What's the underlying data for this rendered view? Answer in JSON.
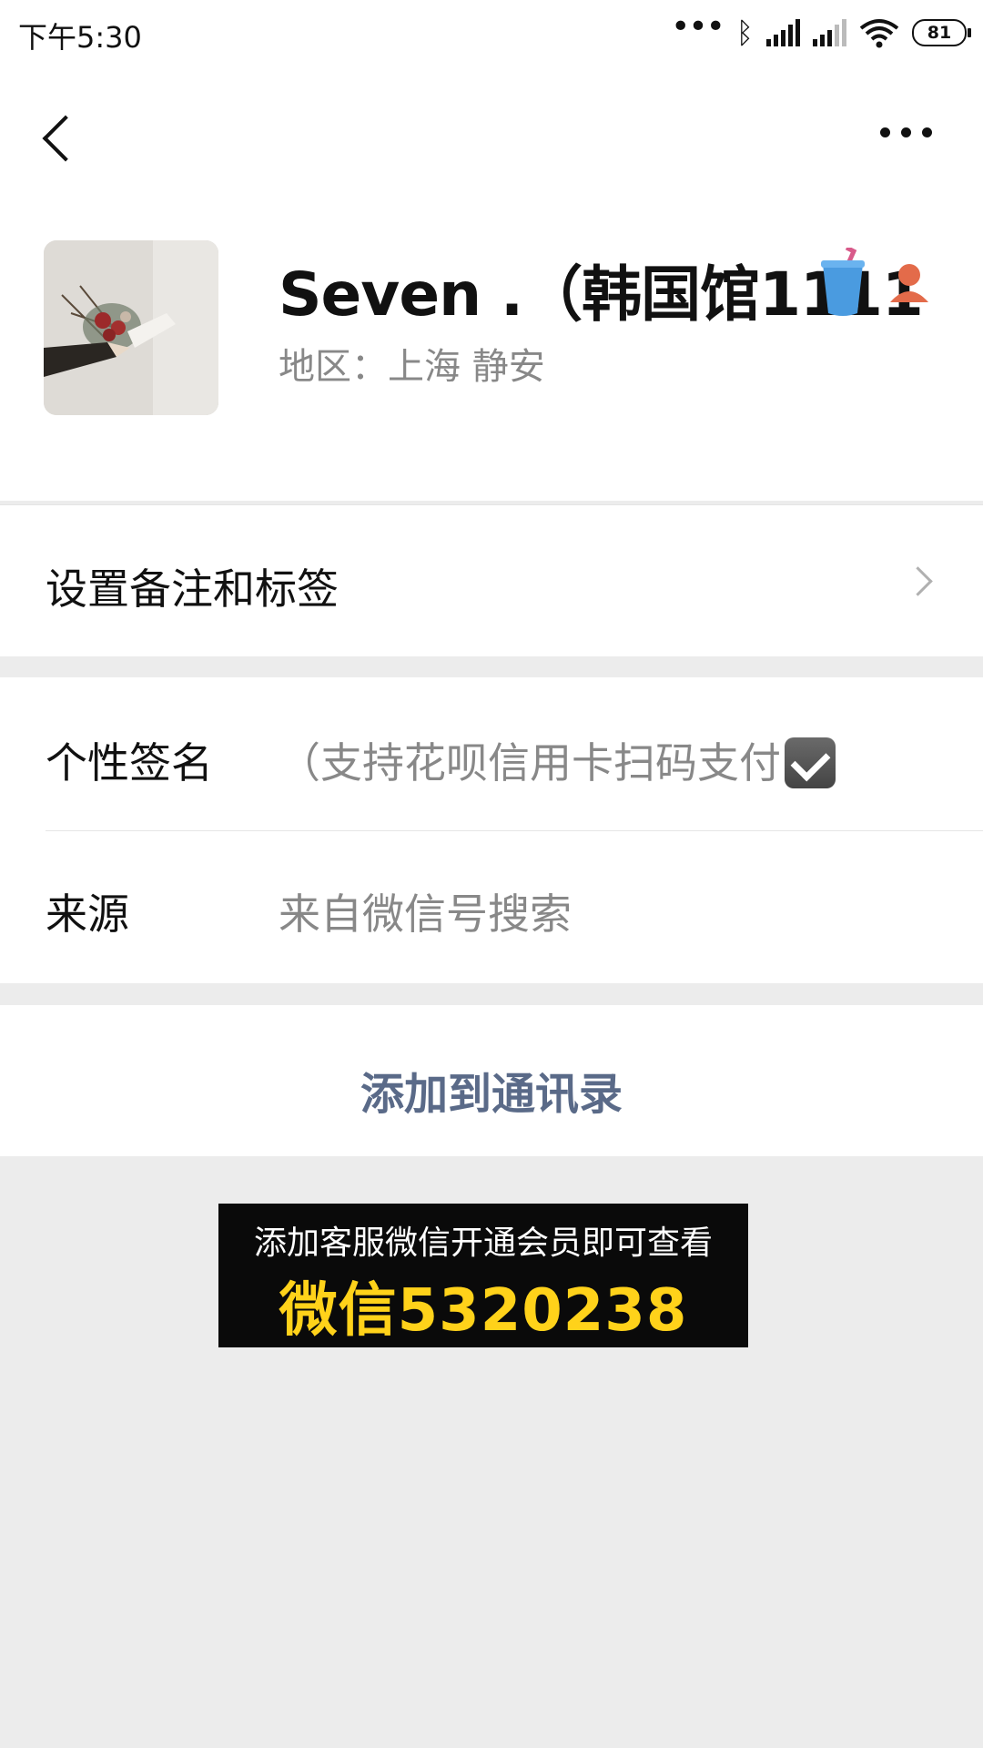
{
  "status_bar": {
    "time": "下午5:30",
    "battery": "81"
  },
  "nav": {
    "back_icon": "chevron-left-icon",
    "more_icon": "more-icon"
  },
  "profile": {
    "name": "Seven .（韩国馆1111",
    "region": "地区：上海  静安"
  },
  "remarks": {
    "label": "设置备注和标签"
  },
  "info": {
    "signature_label": "个性签名",
    "signature_value": "（支持花呗信用卡扫码支付",
    "source_label": "来源",
    "source_value": "来自微信号搜索"
  },
  "actions": {
    "add_contact": "添加到通讯录"
  },
  "banner": {
    "top_text": "添加客服微信开通会员即可查看",
    "big_text": "微信5320238"
  },
  "colors": {
    "link": "#5a6a88",
    "banner_bg": "#0a0a0a",
    "banner_highlight": "#ffd21a"
  }
}
